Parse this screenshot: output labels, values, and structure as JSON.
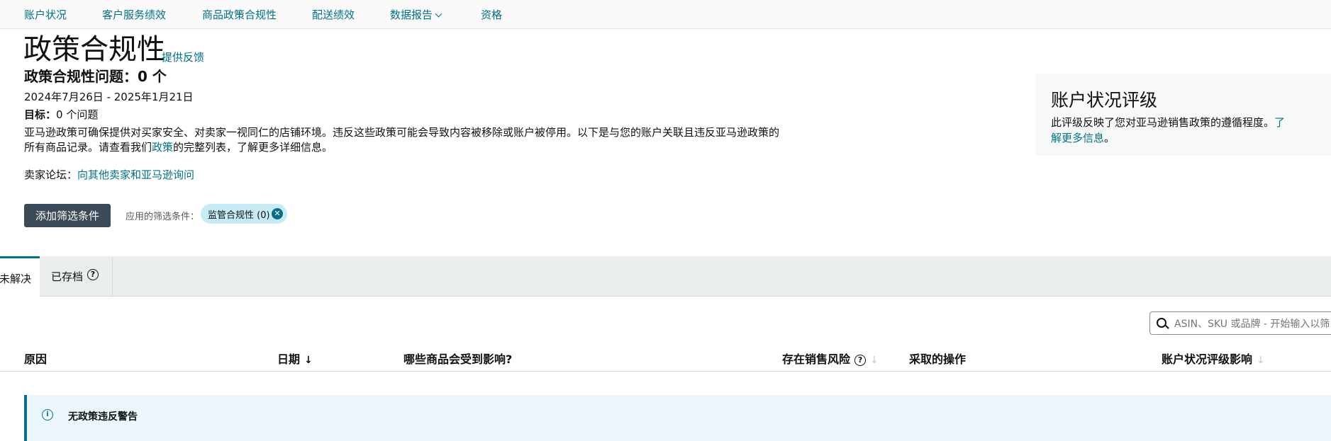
{
  "nav": {
    "items": [
      "账户状况",
      "客户服务绩效",
      "商品政策合规性",
      "配送绩效",
      "数据报告",
      "资格"
    ]
  },
  "page": {
    "title": "政策合规性",
    "feedback_link": "提供反馈",
    "issues_heading": "政策合规性问题：0 个",
    "date_range": "2024年7月26日 - 2025年1月21日",
    "target_label": "目标：",
    "target_value": "0 个问题",
    "description_pre": "亚马逊政策可确保提供对买家安全、对卖家一视同仁的店铺环境。违反这些政策可能会导致内容被移除或账户被停用。以下是与您的账户关联且违反亚马逊政策的所有商品记录。请查看我们",
    "description_link": "政策",
    "description_post": "的完整列表，了解更多详细信息。",
    "forum_label": "卖家论坛：",
    "forum_link": "向其他卖家和亚马逊询问"
  },
  "filters": {
    "add_button": "添加筛选条件",
    "applied_label": "应用的筛选条件：",
    "chip_label": "监管合规性 (0)"
  },
  "rating_card": {
    "title": "账户状况评级",
    "text_pre": "此评级反映了您对亚马逊销售政策的遵循程度。",
    "text_link": "了解更多信息",
    "text_post": "。"
  },
  "tabs": {
    "active": "未解决",
    "archived": "已存档"
  },
  "search": {
    "placeholder": "ASIN、SKU 或品牌 - 开始输入以筛"
  },
  "table": {
    "headers": [
      "原因",
      "日期",
      "哪些商品会受到影响?",
      "存在销售风险",
      "采取的操作",
      "账户状况评级影响"
    ]
  },
  "alert": {
    "message": "无政策违反警告"
  }
}
